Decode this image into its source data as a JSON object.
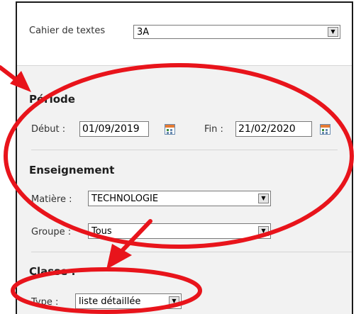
{
  "cahier": {
    "label": "Cahier de textes",
    "selected": "3A"
  },
  "periode": {
    "heading": "Période",
    "debut_label": "Début :",
    "debut_value": "01/09/2019",
    "fin_label": "Fin :",
    "fin_value": "21/02/2020"
  },
  "enseignement": {
    "heading": "Enseignement",
    "matiere_label": "Matière :",
    "matiere_value": "TECHNOLOGIE",
    "groupe_label": "Groupe :",
    "groupe_value": "Tous"
  },
  "classe": {
    "heading": "Classe :",
    "type_label": "Type :",
    "type_value": "liste détaillée"
  },
  "colors": {
    "annotation_red": "#e8141b",
    "panel_bg": "#f2f2f2",
    "calendar_header": "#e57b33"
  },
  "icons": {
    "dropdown": "chevron-down-icon",
    "calendar": "calendar-icon"
  }
}
